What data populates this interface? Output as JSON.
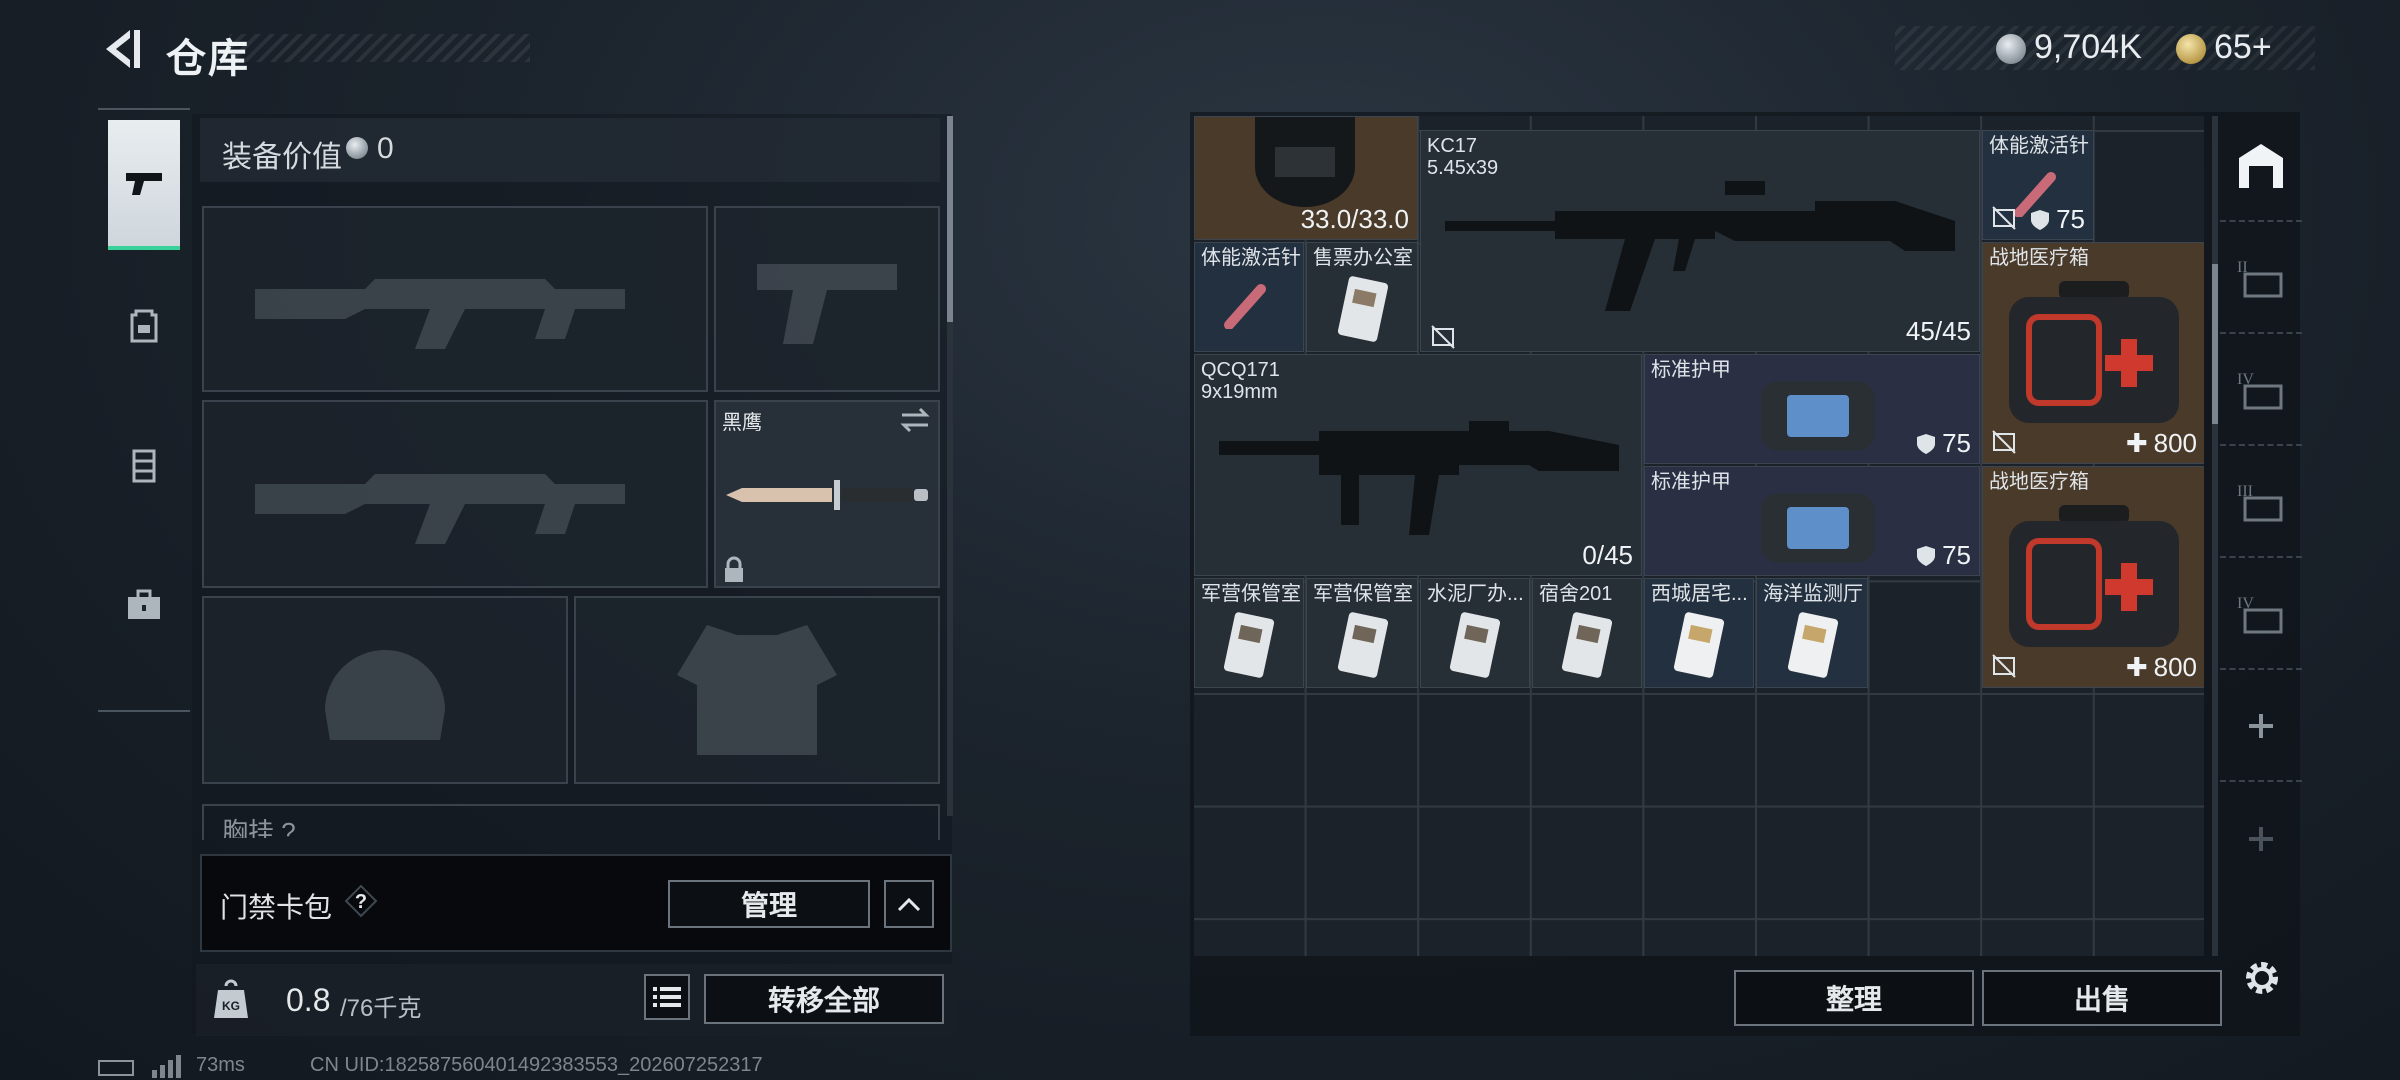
{
  "header": {
    "title": "仓库",
    "currency_1": "9,704K",
    "currency_2": "65+"
  },
  "equipment": {
    "value_label": "装备价值",
    "value": "0",
    "melee_name": "黑鹰",
    "chest_label": "胸挂 ?"
  },
  "keycard": {
    "label": "门禁卡包",
    "manage_label": "管理"
  },
  "weight": {
    "current": "0.8",
    "max": "/76千克"
  },
  "buttons": {
    "transfer_all": "转移全部",
    "sort": "整理",
    "sell": "出售"
  },
  "status": {
    "ping": "73ms",
    "uid": "CN UID:18258756040149238355​3_202607252317"
  },
  "storage": {
    "helmet_durability": "33.0/33.0",
    "kc17": {
      "name": "KC17",
      "caliber": "5.45x39",
      "ammo": "45/45"
    },
    "stim_1": {
      "name": "体能激活针",
      "armor": "75"
    },
    "stim_2": {
      "name": "体能激活针"
    },
    "card_ticket": {
      "name": "售票办公室"
    },
    "medkit_1": {
      "name": "战地医疗箱",
      "heal": "800"
    },
    "medkit_2": {
      "name": "战地医疗箱",
      "heal": "800"
    },
    "qcq171": {
      "name": "QCQ171",
      "caliber": "9x19mm",
      "ammo": "0/45"
    },
    "armor_1": {
      "name": "标准护甲",
      "armor": "75"
    },
    "armor_2": {
      "name": "标准护甲",
      "armor": "75"
    },
    "keycards": [
      {
        "name": "军营保管室"
      },
      {
        "name": "军营保管室"
      },
      {
        "name": "水泥厂办..."
      },
      {
        "name": "宿舍201"
      },
      {
        "name": "西城居宅..."
      },
      {
        "name": "海洋监测厅"
      }
    ]
  },
  "colors": {
    "accent_green": "#37d19a",
    "medkit_bg": "#4a3a2a",
    "rare_blue": "#23303f",
    "rare_purple": "#2b2f44"
  }
}
